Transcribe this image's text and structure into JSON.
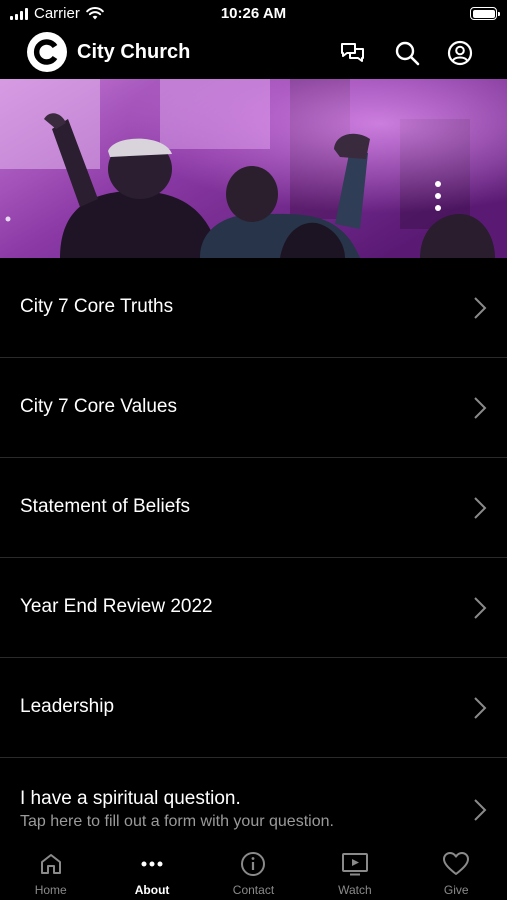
{
  "status_bar": {
    "carrier": "Carrier",
    "time": "10:26 AM"
  },
  "header": {
    "title": "City Church",
    "icons": [
      "chat-icon",
      "search-icon",
      "profile-icon"
    ]
  },
  "hero": {
    "description_icon": "worship-photo"
  },
  "menu": {
    "items": [
      {
        "label": "City 7 Core Truths"
      },
      {
        "label": "City 7 Core Values"
      },
      {
        "label": "Statement of Beliefs"
      },
      {
        "label": "Year End Review 2022"
      },
      {
        "label": "Leadership"
      },
      {
        "label": "I have a spiritual question.",
        "subtitle": "Tap here to fill out a form with your question."
      }
    ]
  },
  "tabbar": {
    "active": "About",
    "tabs": [
      {
        "label": "Home",
        "icon": "home-icon"
      },
      {
        "label": "About",
        "icon": "more-dots-icon"
      },
      {
        "label": "Contact",
        "icon": "info-icon"
      },
      {
        "label": "Watch",
        "icon": "tv-play-icon"
      },
      {
        "label": "Give",
        "icon": "heart-icon"
      }
    ]
  },
  "colors": {
    "background": "#000000",
    "hero_tint": "#b44ad6",
    "inactive_tab": "#8a8a8a"
  }
}
